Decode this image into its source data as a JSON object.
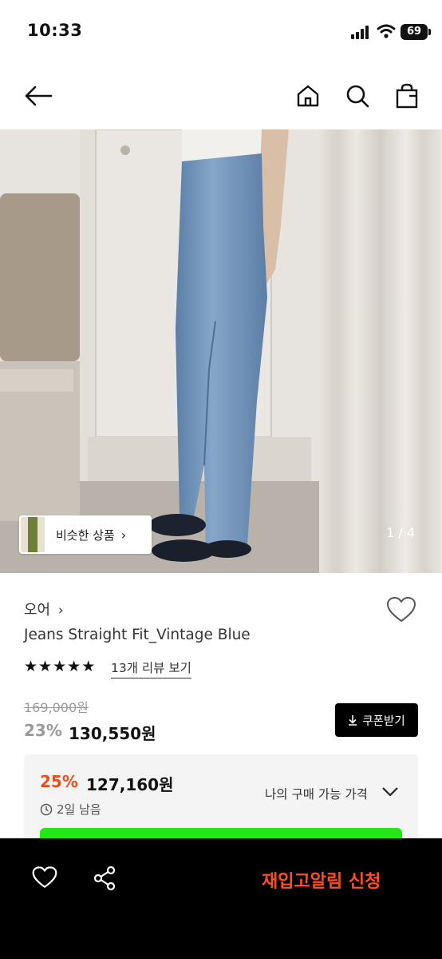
{
  "status_bar": {
    "time": "10:33",
    "battery": "69"
  },
  "nav": {
    "icons": [
      "back-arrow-icon",
      "home-icon",
      "search-icon",
      "shopping-bag-icon"
    ]
  },
  "hero": {
    "similar_products_label": "비슷한 상품",
    "image_counter": "1 / 4"
  },
  "product": {
    "brand": "오어",
    "name": "Jeans Straight Fit_Vintage Blue",
    "rating_stars": 5,
    "review_link": "13개 리뷰 보기",
    "original_price": "169,000원",
    "discount_rate": "23%",
    "price": "130,550원",
    "coupon_button": "쿠폰받기"
  },
  "best_price": {
    "discount_rate": "25%",
    "price": "127,160원",
    "time_left": "2일 남음",
    "toggle_label": "나의 구매 가능 가격",
    "accent_color": "#ee4c1d",
    "bar_color": "#22e916"
  },
  "bottom_bar": {
    "restock_label": "재입고알림 신청",
    "restock_color": "#ff4d1c"
  }
}
